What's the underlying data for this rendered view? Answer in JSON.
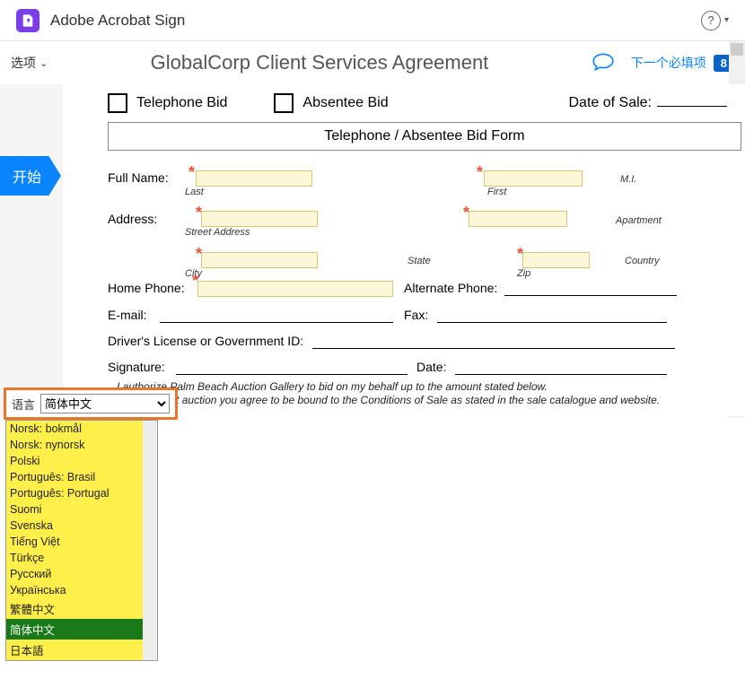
{
  "header": {
    "app_title": "Adobe Acrobat Sign"
  },
  "toolbar": {
    "options_label": "选项",
    "doc_title": "GlobalCorp Client Services Agreement",
    "next_required_label": "下一个必填项",
    "required_count": "8"
  },
  "sidebar": {
    "start_label": "开始"
  },
  "form": {
    "telephone_bid": "Telephone Bid",
    "absentee_bid": "Absentee Bid",
    "date_of_sale": "Date of Sale:",
    "form_title": "Telephone / Absentee Bid Form",
    "full_name": "Full Name:",
    "last": "Last",
    "first": "First",
    "mi": "M.I.",
    "address": "Address:",
    "street_address": "Street Address",
    "apartment": "Apartment",
    "city": "City",
    "state": "State",
    "zip": "Zip",
    "country": "Country",
    "home_phone": "Home Phone:",
    "alt_phone": "Alternate Phone:",
    "email": "E-mail:",
    "fax": "Fax:",
    "license": "Driver's License or Government ID:",
    "signature": "Signature:",
    "date": "Date:",
    "auth_line1": "I authorize Palm Beach Auction Gallery to bid on my behalf up to the amount stated below.",
    "auth_line2": "By bidding at auction you agree to be bound to the Conditions of Sale as stated in the sale catalogue and website."
  },
  "language": {
    "label": "语言",
    "selected": "简体中文",
    "options": [
      "Norsk: bokmål",
      "Norsk: nynorsk",
      "Polski",
      "Português: Brasil",
      "Português: Portugal",
      "Suomi",
      "Svenska",
      "Tiếng Việt",
      "Türkçe",
      "Русский",
      "Українська",
      "繁體中文",
      "简体中文",
      "日本語"
    ]
  }
}
